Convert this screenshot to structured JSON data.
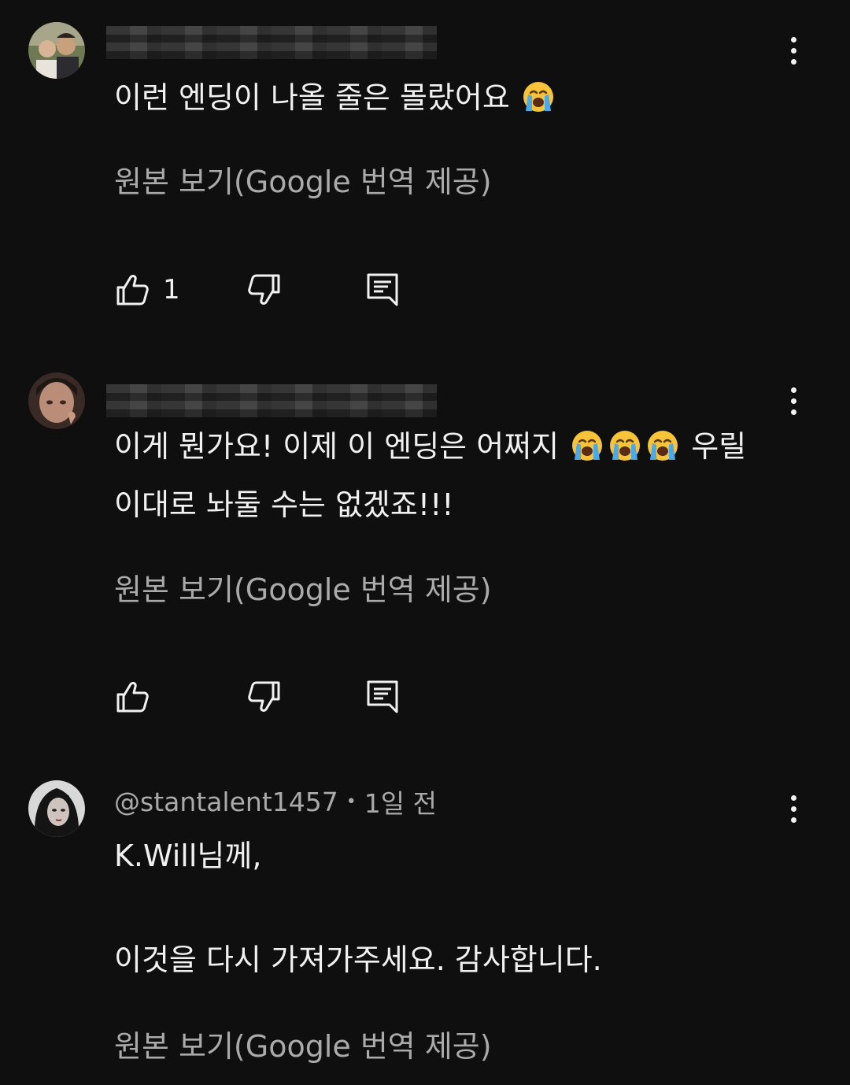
{
  "comments": [
    {
      "author": "",
      "time": "",
      "text_lines": [
        "이런 엔딩이 나올 줄은 몰랐어요"
      ],
      "translate_label": "원본 보기(Google 번역 제공)",
      "like_count": "1"
    },
    {
      "author": "",
      "time": "",
      "text_lines": [
        "이게 뭔가요! 이제 이 엔딩은 어쩌지",
        "우릴",
        "이대로 놔둘 수는 없겠죠!!!"
      ],
      "translate_label": "원본 보기(Google 번역 제공)",
      "like_count": ""
    },
    {
      "author": "@stantalent1457",
      "separator": "•",
      "time": "1일 전",
      "text_lines": [
        "K.Will님께,",
        "이것을 다시 가져가주세요. 감사합니다."
      ],
      "translate_label": "원본 보기(Google 번역 제공)"
    }
  ],
  "icons": {
    "like": "thumbs-up-icon",
    "dislike": "thumbs-down-icon",
    "reply": "reply-comment-icon",
    "more": "more-vertical-icon",
    "emoji": "loudly-crying-face-emoji"
  },
  "colors": {
    "background": "#0f0f0f",
    "primary_text": "#f1f1f1",
    "secondary_text": "#aaaaaa",
    "emoji_yellow": "#f6c33b",
    "emoji_tears": "#4aa9e8"
  }
}
